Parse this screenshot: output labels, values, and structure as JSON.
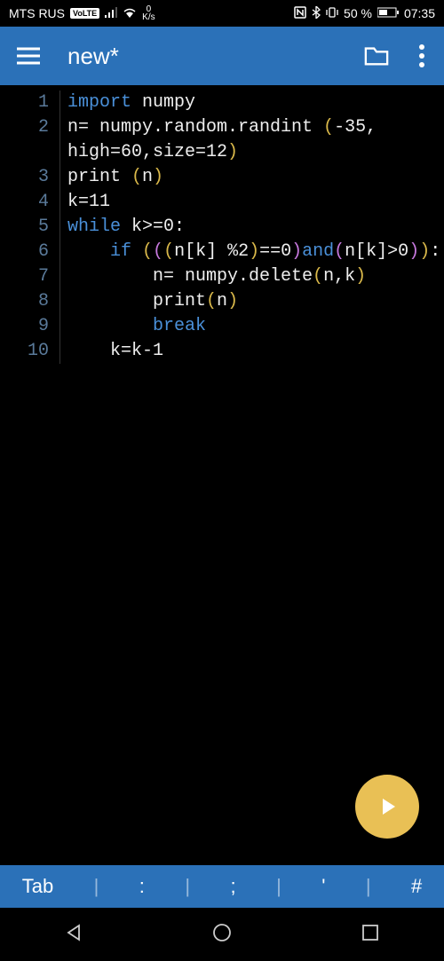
{
  "status": {
    "carrier": "MTS RUS",
    "volte": "VoLTE",
    "data_rate_top": "0",
    "data_rate_bottom": "K/s",
    "battery": "50 %",
    "time": "07:35"
  },
  "app": {
    "title": "new*"
  },
  "code": {
    "lines": [
      {
        "n": "1",
        "segs": [
          [
            "kw",
            "import "
          ],
          [
            "fn",
            "numpy"
          ]
        ]
      },
      {
        "n": "2",
        "segs": [
          [
            "fn",
            "n= numpy.random.randint "
          ],
          [
            "paren-y",
            "("
          ],
          [
            "fn",
            "-35,"
          ]
        ]
      },
      {
        "n": "",
        "segs": [
          [
            "fn",
            "high=60,size=12"
          ],
          [
            "paren-y",
            ")"
          ]
        ]
      },
      {
        "n": "3",
        "segs": [
          [
            "fn",
            "print "
          ],
          [
            "paren-y",
            "("
          ],
          [
            "fn",
            "n"
          ],
          [
            "paren-y",
            ")"
          ]
        ]
      },
      {
        "n": "4",
        "segs": [
          [
            "fn",
            "k=11"
          ]
        ]
      },
      {
        "n": "5",
        "segs": [
          [
            "kw",
            "while "
          ],
          [
            "fn",
            "k>=0:"
          ]
        ]
      },
      {
        "n": "6",
        "segs": [
          [
            "fn",
            "    "
          ],
          [
            "kw",
            "if "
          ],
          [
            "paren-y",
            "("
          ],
          [
            "paren-p",
            "("
          ],
          [
            "paren-y",
            "("
          ],
          [
            "fn",
            "n[k] %2"
          ],
          [
            "paren-y",
            ")"
          ],
          [
            "fn",
            "==0"
          ],
          [
            "paren-p",
            ")"
          ],
          [
            "kw",
            "and"
          ],
          [
            "paren-p",
            "("
          ],
          [
            "fn",
            "n[k]>0"
          ],
          [
            "paren-p",
            ")"
          ],
          [
            "paren-y",
            ")"
          ],
          [
            "fn",
            ":"
          ]
        ]
      },
      {
        "n": "7",
        "segs": [
          [
            "fn",
            "        n= numpy.delete"
          ],
          [
            "paren-y",
            "("
          ],
          [
            "fn",
            "n,k"
          ],
          [
            "paren-y",
            ")"
          ]
        ]
      },
      {
        "n": "8",
        "segs": [
          [
            "fn",
            "        print"
          ],
          [
            "paren-y",
            "("
          ],
          [
            "fn",
            "n"
          ],
          [
            "paren-y",
            ")"
          ]
        ]
      },
      {
        "n": "9",
        "segs": [
          [
            "fn",
            "        "
          ],
          [
            "kw",
            "break"
          ]
        ]
      },
      {
        "n": "10",
        "segs": [
          [
            "fn",
            "    k=k-1"
          ]
        ]
      }
    ]
  },
  "keys": {
    "k1": "Tab",
    "k2": ":",
    "k3": ";",
    "k4": "'",
    "k5": "#"
  }
}
